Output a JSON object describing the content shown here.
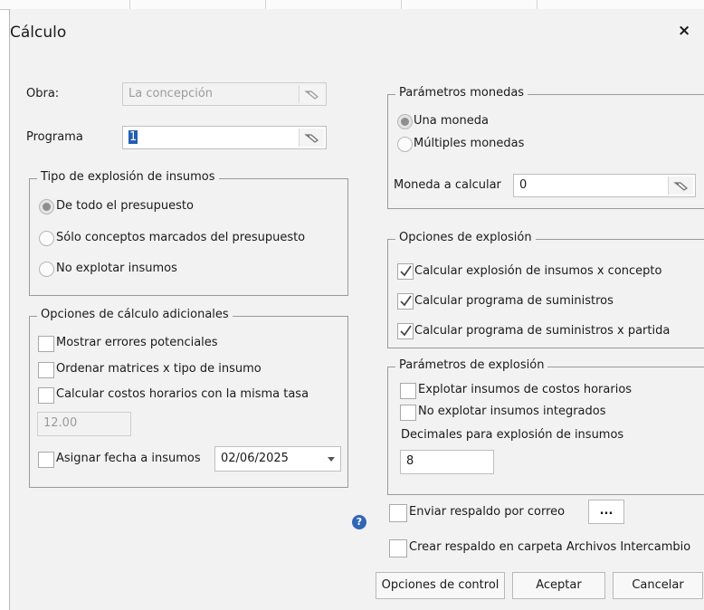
{
  "dialog": {
    "title": "Cálculo",
    "close": "×"
  },
  "left": {
    "obra": {
      "label": "Obra:",
      "value": "La concepción"
    },
    "programa": {
      "label": "Programa",
      "value": "1"
    },
    "tipo_explosion": {
      "title": "Tipo de explosión de insumos",
      "options": [
        "De todo el presupuesto",
        "Sólo conceptos marcados del presupuesto",
        "No explotar insumos"
      ],
      "selected_index": 0
    },
    "opciones_calculo": {
      "title": "Opciones de cálculo adicionales",
      "checks": [
        "Mostrar errores potenciales",
        "Ordenar matrices x tipo de insumo",
        "Calcular costos horarios con la misma tasa"
      ],
      "tasa_value": "12.00",
      "asignar_label": "Asignar fecha a insumos",
      "fecha_value": "02/06/2025"
    }
  },
  "right": {
    "param_monedas": {
      "title": "Parámetros monedas",
      "options": [
        "Una moneda",
        "Múltiples monedas"
      ],
      "selected_index": 0,
      "moneda_label": "Moneda a calcular",
      "moneda_value": "0"
    },
    "opciones_explosion": {
      "title": "Opciones de explosión",
      "checks": [
        "Calcular explosión de insumos x concepto",
        "Calcular programa de suministros",
        "Calcular programa de suministros x partida"
      ]
    },
    "param_explosion": {
      "title": "Parámetros de explosión",
      "checks": [
        "Explotar insumos de costos horarios",
        "No explotar insumos integrados"
      ],
      "decimales_label": "Decimales para explosión de insumos",
      "decimales_value": "8"
    }
  },
  "bottom": {
    "help": "?",
    "enviar_label": "Enviar respaldo por correo",
    "ellipsis": "...",
    "crear_label": "Crear respaldo en carpeta Archivos Intercambio",
    "buttons": {
      "opciones": "Opciones de control",
      "aceptar": "Aceptar",
      "cancelar": "Cancelar"
    }
  }
}
